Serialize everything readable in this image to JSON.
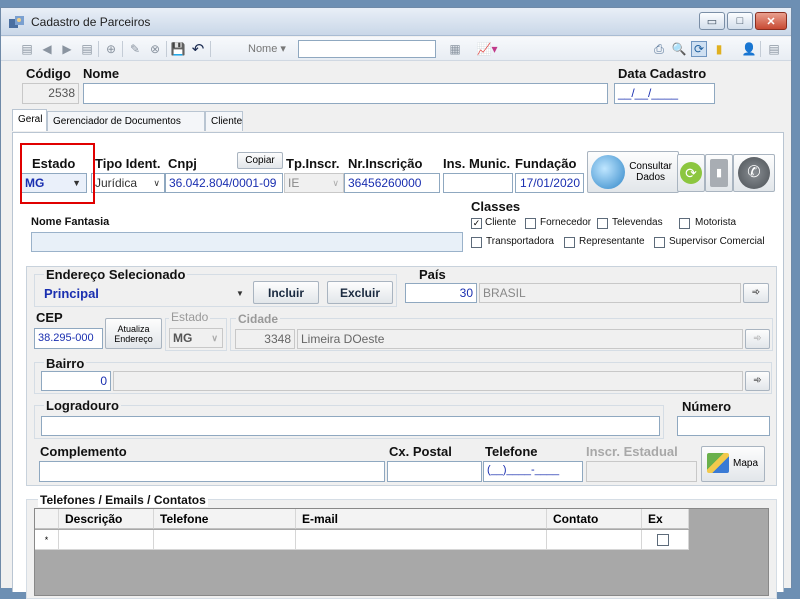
{
  "window": {
    "title": "Cadastro de Parceiros"
  },
  "toolbar": {
    "name_label": "Nome",
    "name_value": ""
  },
  "header": {
    "codigo_label": "Código",
    "codigo_value": "2538",
    "nome_label": "Nome",
    "nome_value": "",
    "data_label": "Data Cadastro",
    "data_value": "__/__/____"
  },
  "tabs": [
    {
      "label": "Geral"
    },
    {
      "label": "Gerenciador de Documentos"
    },
    {
      "label": "Cliente"
    }
  ],
  "top_row": {
    "estado_label": "Estado",
    "estado_value": "MG",
    "tipo_label": "Tipo Ident.",
    "tipo_value": "Jurídica",
    "cnpj_label": "Cnpj",
    "copiar_label": "Copiar",
    "cnpj_value": "36.042.804/0001-09",
    "tpinscr_label": "Tp.Inscr.",
    "tpinscr_value": "IE",
    "nrinscr_label": "Nr.Inscrição",
    "nrinscr_value": "36456260000",
    "insmunic_label": "Ins. Munic.",
    "insmunic_value": "",
    "fundacao_label": "Fundação",
    "fundacao_value": "17/01/2020",
    "consultar_label": "Consultar\nDados"
  },
  "nome_fantasia": {
    "label": "Nome Fantasia",
    "value": ""
  },
  "classes": {
    "label": "Classes",
    "items": [
      {
        "label": "Cliente",
        "checked": "✓"
      },
      {
        "label": "Fornecedor",
        "checked": ""
      },
      {
        "label": "Televendas",
        "checked": ""
      },
      {
        "label": "Motorista",
        "checked": ""
      },
      {
        "label": "Transportadora",
        "checked": ""
      },
      {
        "label": "Representante",
        "checked": ""
      },
      {
        "label": "Supervisor Comercial",
        "checked": ""
      }
    ]
  },
  "endereco": {
    "sel_label": "Endereço Selecionado",
    "sel_value": "Principal",
    "incluir_label": "Incluir",
    "excluir_label": "Excluir",
    "pais_label": "País",
    "pais_code": "30",
    "pais_name": "BRASIL",
    "cep_label": "CEP",
    "cep_value": "38.295-000",
    "atualiza_label": "Atualiza\nEndereço",
    "estado_label": "Estado",
    "estado_value": "MG",
    "cidade_label": "Cidade",
    "cidade_code": "3348",
    "cidade_name": "Limeira DOeste",
    "bairro_label": "Bairro",
    "bairro_code": "0",
    "bairro_name": "",
    "logradouro_label": "Logradouro",
    "logradouro_value": "",
    "numero_label": "Número",
    "numero_value": "",
    "complemento_label": "Complemento",
    "complemento_value": "",
    "cxpostal_label": "Cx. Postal",
    "cxpostal_value": "",
    "telefone_label": "Telefone",
    "telefone_value": "(__)____-____",
    "inscr_label": "Inscr. Estadual",
    "inscr_value": "",
    "mapa_label": "Mapa"
  },
  "contatos": {
    "label": "Telefones / Emails / Contatos",
    "columns": [
      "Descrição",
      "Telefone",
      "E-mail",
      "Contato",
      "Ex"
    ],
    "row_marker": "*"
  }
}
